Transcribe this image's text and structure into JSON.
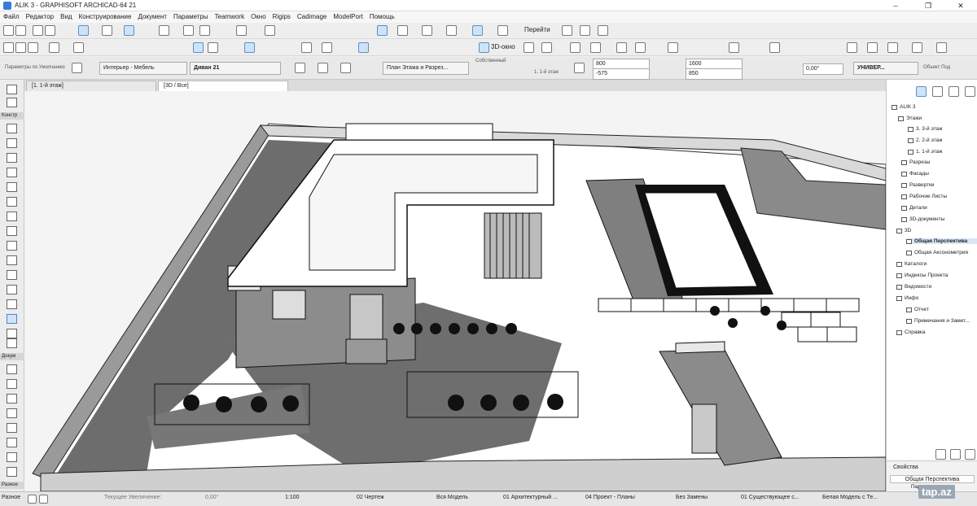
{
  "app": {
    "title": "ALIK 3 - GRAPHISOFT ARCHICAD-64 21",
    "window_controls": [
      "–",
      "❐",
      "✕"
    ]
  },
  "menu": [
    "Файл",
    "Редактор",
    "Вид",
    "Конструирование",
    "Документ",
    "Параметры",
    "Teamwork",
    "Окно",
    "Rigips",
    "Cadimage",
    "ModelPort",
    "Помощь"
  ],
  "toolbar": {
    "view_3d_label": "3D-окно",
    "goto_label": "Перейти",
    "tune_label": "Собственный"
  },
  "infobox": {
    "defaults_label": "Параметры по Умолчанию",
    "layer_value": "Интерьер - Мебель",
    "object_name": "Диван 21",
    "view_mode": "План Этажа и Разрез...",
    "floor_hint": "1. 1-й этаж",
    "dim_a": "800",
    "dim_b": "-575",
    "dim_c": "1600",
    "dim_d": "850",
    "angle": "0,00°",
    "universal": "УНИВЕР...",
    "object_label": "Объект Под"
  },
  "tabs": [
    {
      "label": "[1. 1-й этаж]"
    },
    {
      "label": "[3D / Все]"
    }
  ],
  "toolbox": {
    "section_design": "Констр",
    "section_docs": "Докум",
    "section_other": "Разное"
  },
  "navigator": {
    "project": "ALIK 3",
    "stories_label": "Этажи",
    "stories": [
      "3. 3-й этаж",
      "2. 2-й этаж",
      "1. 1-й этаж"
    ],
    "items": [
      "Разрезы",
      "Фасады",
      "Развертки",
      "Рабочие Листы",
      "Детали",
      "3D-документы"
    ],
    "group_3d": "3D",
    "items_3d": [
      "Общая Перспектива",
      "Общая Аксонометрия"
    ],
    "groups": [
      "Каталоги",
      "Индексы Проекта",
      "Ведомости"
    ],
    "info_label": "Инфо",
    "info_items": [
      "Отчет",
      "Примечания и Замет..."
    ],
    "help_label": "Справка",
    "props_title": "Свойства",
    "props_value": "Общая Перспектива",
    "props_field": "Пара"
  },
  "statusbar": {
    "zoom_label": "Текущее Увеличение:",
    "angle": "0,00°",
    "scale": "1:100",
    "drawing": "02 Чертеж",
    "model": "Вся Модель",
    "arch": "01 Архитектурный ...",
    "project_plans": "04 Проект - Планы",
    "override": "Без Замены",
    "existing": "01 Существующее с...",
    "white_model": "Белая Модель с Те..."
  },
  "watermark": "tap.az",
  "colors": {
    "accent": "#3a7bd5",
    "selection": "#cfe3f7",
    "shadow": "#7a7a7a",
    "surface": "#ffffff"
  }
}
